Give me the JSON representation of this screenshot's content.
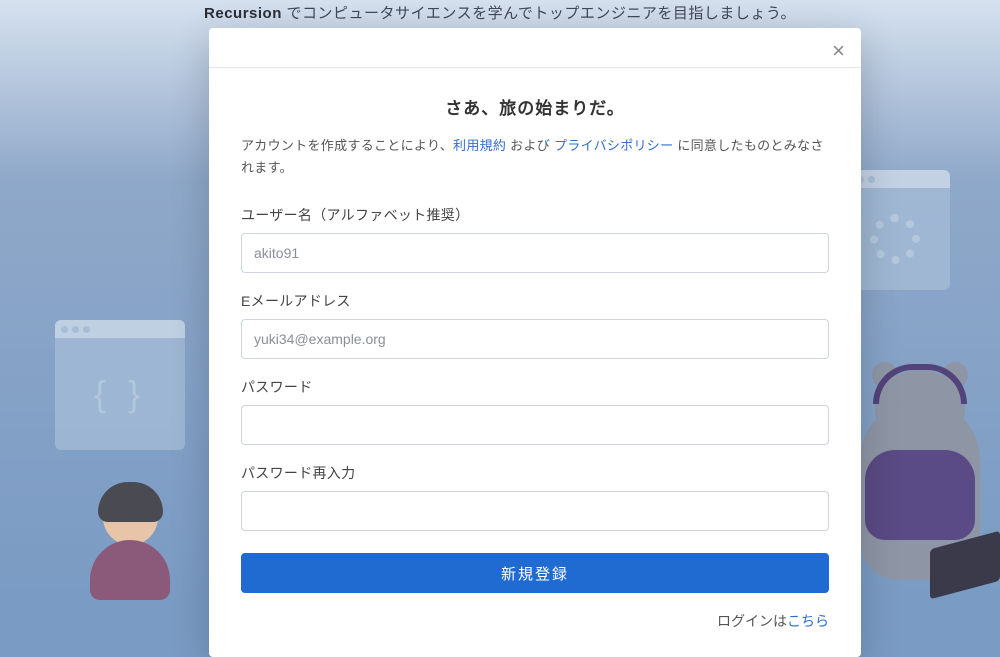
{
  "tagline": {
    "brand": "Recursion",
    "rest": " でコンピュータサイエンスを学んでトップエンジニアを目指しましょう。"
  },
  "modal": {
    "title": "さあ、旅の始まりだ。",
    "agreement": {
      "prefix": "アカウントを作成することにより、",
      "terms": "利用規約",
      "middle": " および ",
      "privacy": "プライバシポリシー",
      "suffix": " に同意したものとみなされます。"
    },
    "fields": {
      "username": {
        "label": "ユーザー名（アルファベット推奨）",
        "placeholder": "akito91"
      },
      "email": {
        "label": "Eメールアドレス",
        "placeholder": "yuki34@example.org"
      },
      "password": {
        "label": "パスワード"
      },
      "password_confirm": {
        "label": "パスワード再入力"
      }
    },
    "submit_label": "新規登録",
    "login": {
      "prefix": "ログインは",
      "link": "こちら"
    },
    "close_label": "×"
  }
}
